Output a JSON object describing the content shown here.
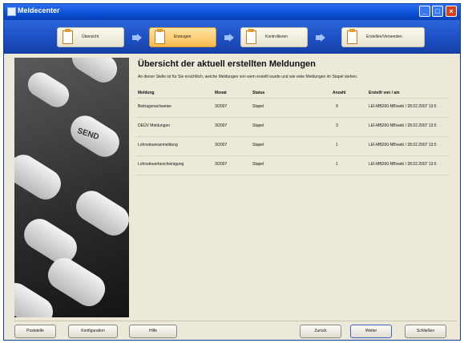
{
  "window": {
    "title": "Meldecenter"
  },
  "wizard": {
    "steps": [
      {
        "label": "Übersicht"
      },
      {
        "label": "Erzeugen"
      },
      {
        "label": "Kontrollieren"
      },
      {
        "label": "Erstellen/Versenden"
      }
    ]
  },
  "content": {
    "heading": "Übersicht der aktuell erstellten Meldungen",
    "subtitle": "An dieser Stelle ist für Sie ersichtlich, welche Meldungen von wem erstellt wurde und wie viele Meldungen im Stapel stehen.",
    "columns": [
      "Meldung",
      "Monat",
      "Status",
      "Anzahl",
      "Erstellt von / am"
    ],
    "rows": [
      [
        "Beitragsnachweise",
        "3/2007",
        "Stapel",
        "9",
        "LEI-MB200-NB\\web / 28.02.2007 13:5"
      ],
      [
        "DEÜV Meldungen",
        "3/2007",
        "Stapel",
        "3",
        "LEI-MB200-NB\\web / 28.02.2007 13:5"
      ],
      [
        "Lohnsteueranmeldung",
        "3/2007",
        "Stapel",
        "1",
        "LEI-MB200-NB\\web / 28.02.2007 13:5"
      ],
      [
        "Lohnsteuerbescheinigung",
        "3/2007",
        "Stapel",
        "1",
        "LEI-MB200-NB\\web / 28.02.2007 13:5"
      ]
    ]
  },
  "photo": {
    "send_label": "SEND"
  },
  "buttons": {
    "poststelle": "Poststelle",
    "konfiguration": "Konfiguration",
    "hilfe": "Hilfe",
    "zurueck": "Zurück",
    "weiter": "Weiter",
    "schliessen": "Schließen"
  }
}
